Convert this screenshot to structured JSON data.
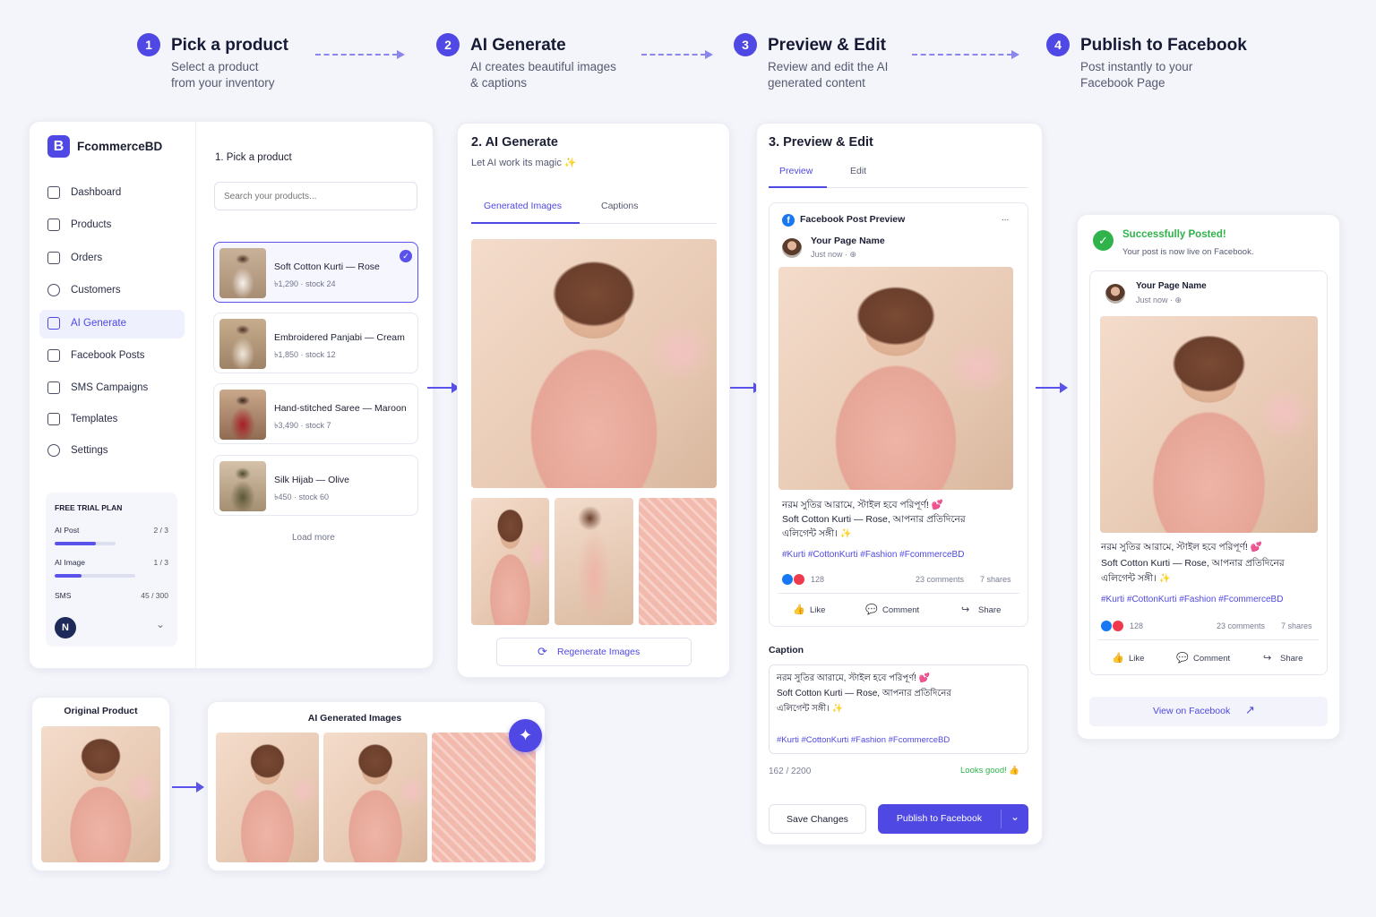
{
  "steps": [
    {
      "num": "1",
      "title": "Pick a product",
      "desc1": "Select a product",
      "desc2": "from your inventory"
    },
    {
      "num": "2",
      "title": "AI Generate",
      "desc1": "AI creates beautiful images",
      "desc2": "& captions"
    },
    {
      "num": "3",
      "title": "Preview & Edit",
      "desc1": "Review and edit the AI",
      "desc2": "generated content"
    },
    {
      "num": "4",
      "title": "Publish to Facebook",
      "desc1": "Post instantly to your",
      "desc2": "Facebook Page"
    }
  ],
  "app": {
    "logo_letter": "B",
    "brand": "FcommerceBD",
    "nav": [
      "Dashboard",
      "Products",
      "Orders",
      "Customers",
      "AI Generate",
      "Facebook Posts",
      "SMS Campaigns",
      "Templates",
      "Settings"
    ],
    "plan": {
      "title": "FREE TRIAL PLAN",
      "usage": [
        {
          "label": "AI Post",
          "value": "2 / 3",
          "fraction": 0.67
        },
        {
          "label": "AI Image",
          "value": "1 / 3",
          "fraction": 0.33
        },
        {
          "label": "SMS",
          "value": "45 / 300",
          "fraction": 0.15
        }
      ],
      "user_initial": "N",
      "chevron": "⌄"
    }
  },
  "pick": {
    "heading": "1. Pick a product",
    "search_placeholder": "Search your products...",
    "products": [
      {
        "name": "Soft Cotton Kurti — Rose",
        "meta": "৳1,290 · stock 24"
      },
      {
        "name": "Embroidered Panjabi — Cream",
        "meta": "৳1,850 · stock 12"
      },
      {
        "name": "Hand-stitched Saree — Maroon",
        "meta": "৳3,490 · stock 7"
      },
      {
        "name": "Silk Hijab — Olive",
        "meta": "৳450 · stock 60"
      }
    ],
    "load_more": "Load more",
    "check": "✓"
  },
  "generate": {
    "heading": "2. AI Generate",
    "sub": "Let AI work its magic ✨",
    "tabs": [
      "Generated Images",
      "Captions"
    ],
    "regen": "Regenerate Images",
    "regen_icon": "⟳"
  },
  "preview": {
    "heading": "3. Preview & Edit",
    "tabs": [
      "Preview",
      "Edit"
    ],
    "fb_title": "Facebook Post Preview",
    "more": "...",
    "page_name": "Your Page Name",
    "time": "Just now · ⊕",
    "caption_l1": "নরম সুতির আরামে, স্টাইল হবে পরিপূর্ণ! 💕",
    "caption_l2": "Soft Cotton Kurti — Rose, আপনার প্রতিদিনের",
    "caption_l3": "এলিগেন্ট সঙ্গী। ✨",
    "tags": "#Kurti #CottonKurti #Fashion #FcommerceBD",
    "reactions": "128",
    "comments": "23 comments",
    "shares": "7 shares",
    "like": "Like",
    "comment": "Comment",
    "share": "Share",
    "caption_label": "Caption",
    "counter": "162 / 2200",
    "looks_good": "Looks good! 👍",
    "save": "Save Changes",
    "publish": "Publish to Facebook",
    "dropdown": "⌄",
    "fb_letter": "f"
  },
  "success": {
    "title": "Successfully Posted!",
    "sub": "Your post is now live on Facebook.",
    "check": "✓",
    "page_name": "Your Page Name",
    "time": "Just now · ⊕",
    "caption_l1": "নরম সুতির আরামে, স্টাইল হবে পরিপূর্ণ! 💕",
    "caption_l2": "Soft Cotton Kurti — Rose, আপনার প্রতিদিনের",
    "caption_l3": "এলিগেন্ট সঙ্গী। ✨",
    "tags": "#Kurti #CottonKurti #Fashion #FcommerceBD",
    "reactions": "128",
    "comments": "23 comments",
    "shares": "7 shares",
    "like": "Like",
    "comment": "Comment",
    "share": "Share",
    "view": "View on Facebook",
    "external_icon": "↗"
  },
  "bottom": {
    "original": "Original Product",
    "generated": "AI Generated Images",
    "sparkle": "✦"
  },
  "icons": {
    "like": "👍",
    "comment": "💬",
    "share": "↪"
  },
  "colors": {
    "accent": "#5048e5",
    "success": "#2fb34a",
    "facebook": "#1877f2"
  }
}
